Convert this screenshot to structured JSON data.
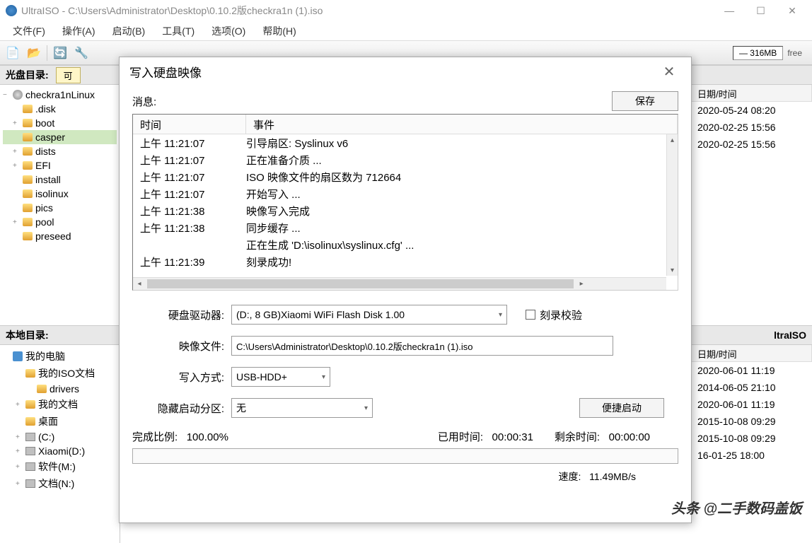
{
  "titlebar": {
    "app_name": "UltraISO",
    "file_path": "C:\\Users\\Administrator\\Desktop\\0.10.2版checkra1n (1).iso"
  },
  "menubar": {
    "items": [
      "文件(F)",
      "操作(A)",
      "启动(B)",
      "工具(T)",
      "选项(O)",
      "帮助(H)"
    ]
  },
  "toolbar": {
    "total_size": "316MB",
    "free_label": "free"
  },
  "disc_panel": {
    "label": "光盘目录:",
    "dropdown": "可",
    "tree_root": "checkra1nLinux",
    "tree_items": [
      {
        "name": ".disk",
        "exp": false
      },
      {
        "name": "boot",
        "exp": true
      },
      {
        "name": "casper",
        "exp": false,
        "selected": true
      },
      {
        "name": "dists",
        "exp": true
      },
      {
        "name": "EFI",
        "exp": true
      },
      {
        "name": "install",
        "exp": false
      },
      {
        "name": "isolinux",
        "exp": false
      },
      {
        "name": "pics",
        "exp": false
      },
      {
        "name": "pool",
        "exp": true
      },
      {
        "name": "preseed",
        "exp": false
      }
    ],
    "list_header_date": "日期/时间",
    "list_dates": [
      "2020-05-24 08:20",
      "2020-02-25 15:56",
      "2020-02-25 15:56"
    ]
  },
  "local_panel": {
    "label": "本地目录:",
    "tree_root": "我的电脑",
    "tree_items": [
      {
        "name": "我的ISO文档",
        "icon": "folder",
        "indent": 1,
        "exp": false
      },
      {
        "name": "drivers",
        "icon": "folder",
        "indent": 2
      },
      {
        "name": "我的文档",
        "icon": "folder",
        "indent": 1,
        "exp": true
      },
      {
        "name": "桌面",
        "icon": "folder",
        "indent": 1
      },
      {
        "name": "(C:)",
        "icon": "drive",
        "indent": 1,
        "exp": true
      },
      {
        "name": "Xiaomi(D:)",
        "icon": "drive",
        "indent": 1,
        "exp": true
      },
      {
        "name": "软件(M:)",
        "icon": "drive",
        "indent": 1,
        "exp": true
      },
      {
        "name": "文档(N:)",
        "icon": "drive",
        "indent": 1,
        "exp": true
      }
    ],
    "right_header": "ltraISO",
    "list_header_date": "日期/时间",
    "list_dates": [
      "2020-06-01 11:19",
      "2014-06-05 21:10",
      "2020-06-01 11:19",
      "2015-10-08 09:29",
      "2015-10-08 09:29",
      "16-01-25 18:00"
    ]
  },
  "dialog": {
    "title": "写入硬盘映像",
    "msg_label": "消息:",
    "save_btn": "保存",
    "log_headers": {
      "time": "时间",
      "event": "事件"
    },
    "log_rows": [
      {
        "t": "上午 11:21:07",
        "e": "引导扇区: Syslinux v6"
      },
      {
        "t": "上午 11:21:07",
        "e": "正在准备介质 ..."
      },
      {
        "t": "上午 11:21:07",
        "e": "ISO 映像文件的扇区数为 712664"
      },
      {
        "t": "上午 11:21:07",
        "e": "开始写入 ..."
      },
      {
        "t": "上午 11:21:38",
        "e": "映像写入完成"
      },
      {
        "t": "上午 11:21:38",
        "e": "同步缓存 ..."
      },
      {
        "t": "",
        "e": "正在生成 'D:\\isolinux\\syslinux.cfg' ..."
      },
      {
        "t": "上午 11:21:39",
        "e": "刻录成功!"
      }
    ],
    "drive_label": "硬盘驱动器:",
    "drive_value": "(D:, 8 GB)Xiaomi  WiFi Flash Disk 1.00",
    "verify_label": "刻录校验",
    "image_label": "映像文件:",
    "image_value": "C:\\Users\\Administrator\\Desktop\\0.10.2版checkra1n (1).iso",
    "method_label": "写入方式:",
    "method_value": "USB-HDD+",
    "hidden_label": "隐藏启动分区:",
    "hidden_value": "无",
    "bootopt_btn": "便捷启动",
    "progress": {
      "pct_label": "完成比例:",
      "pct_value": "100.00%",
      "elapsed_label": "已用时间:",
      "elapsed_value": "00:00:31",
      "remain_label": "剩余时间:",
      "remain_value": "00:00:00",
      "speed_label": "速度:",
      "speed_value": "11.49MB/s"
    }
  },
  "watermark": "头条 @二手数码盖饭"
}
